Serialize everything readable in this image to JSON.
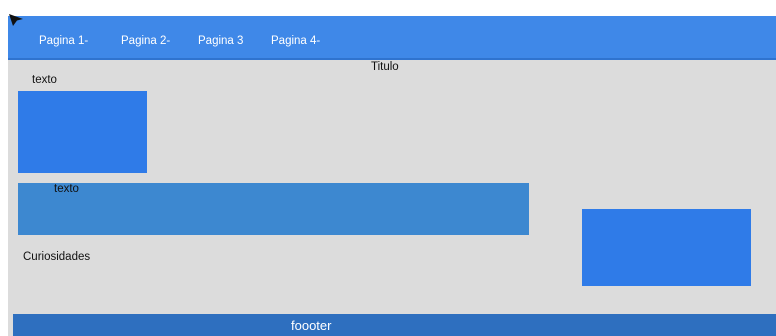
{
  "navbar": {
    "items": [
      {
        "label": "Pagina 1-"
      },
      {
        "label": "Pagina 2-"
      },
      {
        "label": "Pagina 3"
      },
      {
        "label": "Pagina 4-"
      }
    ]
  },
  "main": {
    "title": "Titulo",
    "text_1": "texto",
    "bar_text": "texto",
    "curiosidades": "Curiosidades"
  },
  "footer": {
    "text": "foooter"
  },
  "colors": {
    "navbar": "#3f88e8",
    "page_background": "#dcdcdc",
    "box": "#2f7be8",
    "bar": "#3d88d0",
    "footer": "#2e6fbf"
  },
  "icons": {
    "cursor": "cursor-arrow-icon"
  }
}
